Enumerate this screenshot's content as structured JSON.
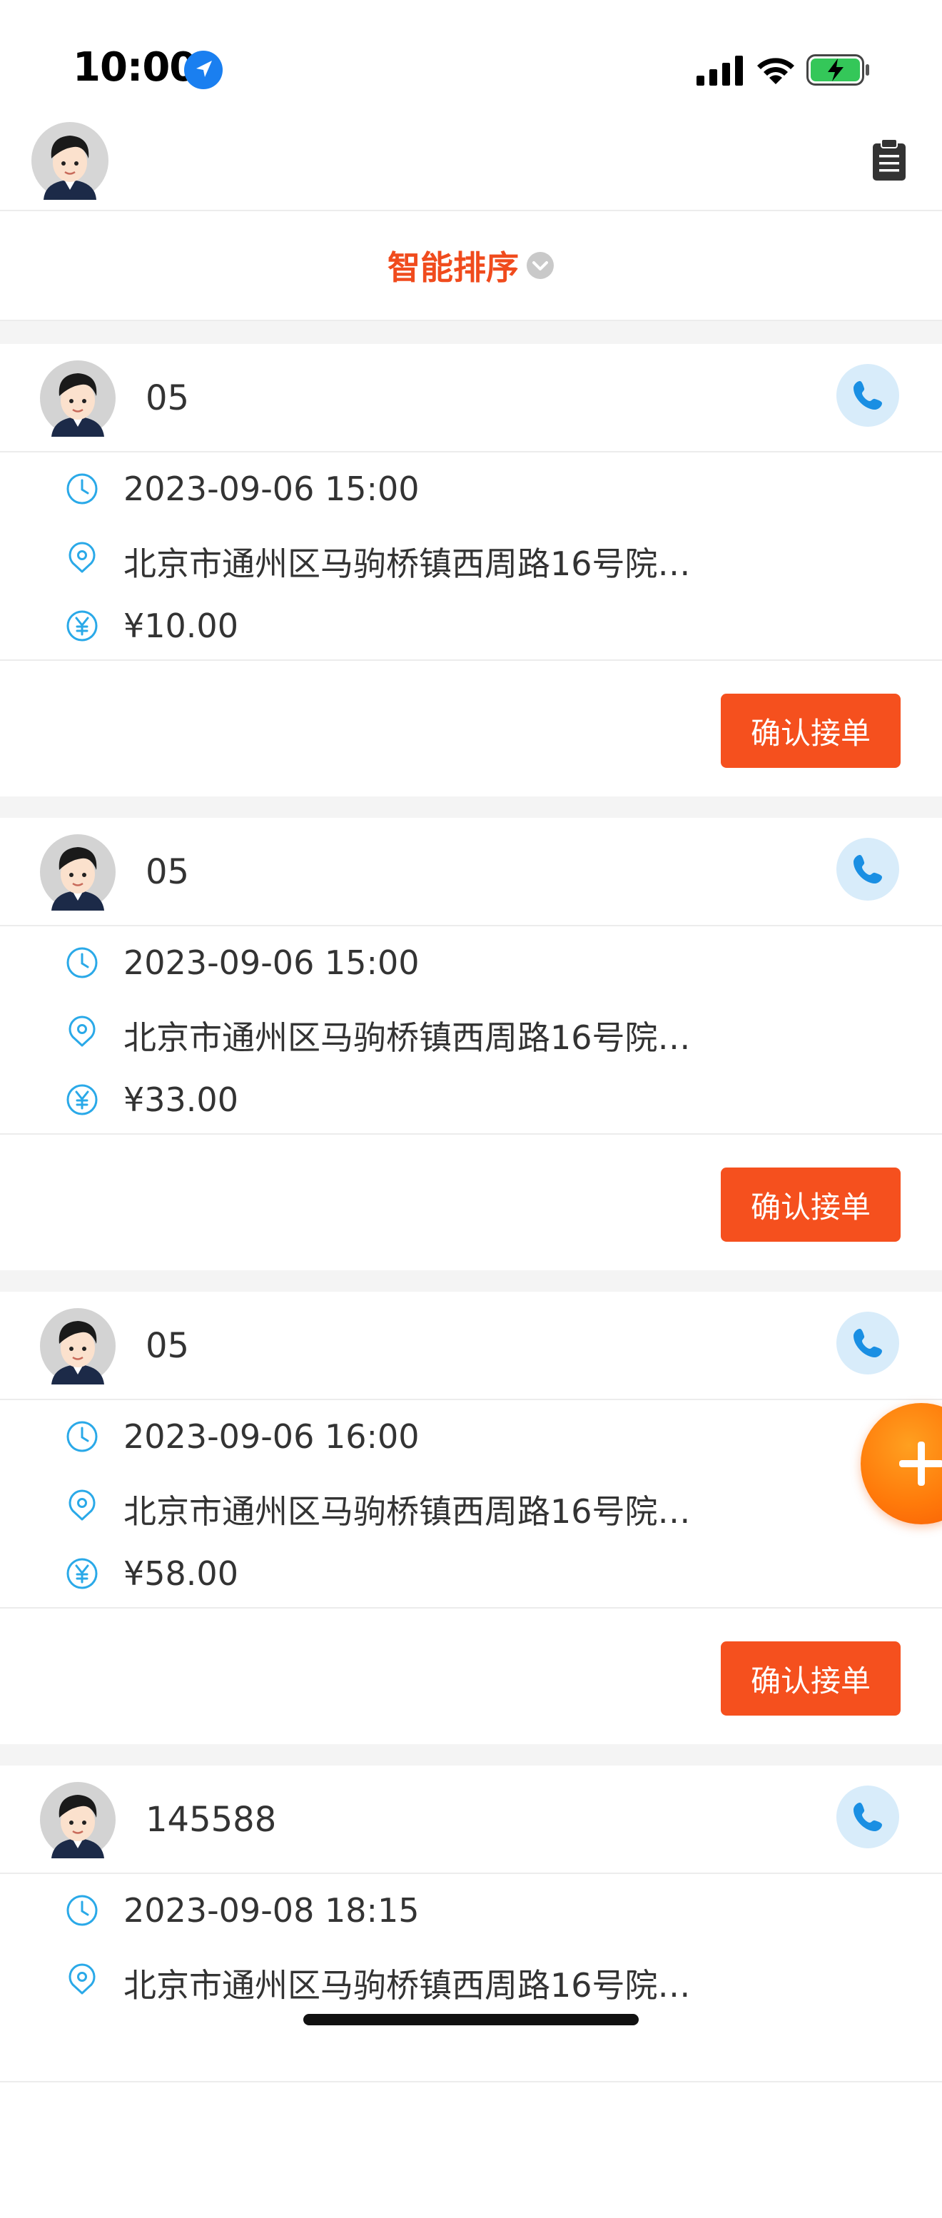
{
  "status_bar": {
    "time": "10:00",
    "icons": [
      "location-arrow-icon",
      "cellular-signal-icon",
      "wifi-icon",
      "battery-charging-icon"
    ]
  },
  "header": {
    "avatar_icon": "user-avatar-icon",
    "right_icon": "clipboard-icon"
  },
  "sort": {
    "label": "智能排序",
    "icon": "chevron-down-icon"
  },
  "orders": [
    {
      "name": "05",
      "time": "2023-09-06 15:00",
      "address": "北京市通州区马驹桥镇西周路16号院…",
      "price": "¥10.00",
      "confirm_label": "确认接单"
    },
    {
      "name": "05",
      "time": "2023-09-06 15:00",
      "address": "北京市通州区马驹桥镇西周路16号院…",
      "price": "¥33.00",
      "confirm_label": "确认接单"
    },
    {
      "name": "05",
      "time": "2023-09-06 16:00",
      "address": "北京市通州区马驹桥镇西周路16号院…",
      "price": "¥58.00",
      "confirm_label": "确认接单"
    },
    {
      "name": "145588",
      "time": "2023-09-08 18:15",
      "address": "北京市通州区马驹桥镇西周路16号院…",
      "price": "",
      "confirm_label": ""
    }
  ],
  "fab": {
    "icon": "plus-icon"
  },
  "colors": {
    "accent": "#f5501e",
    "sort_text": "#f04b1d",
    "info_icon": "#2aa9e8",
    "call_bg": "#d8ecfa",
    "call_icon": "#1a8fe3",
    "fab": "#ff7a0a"
  }
}
